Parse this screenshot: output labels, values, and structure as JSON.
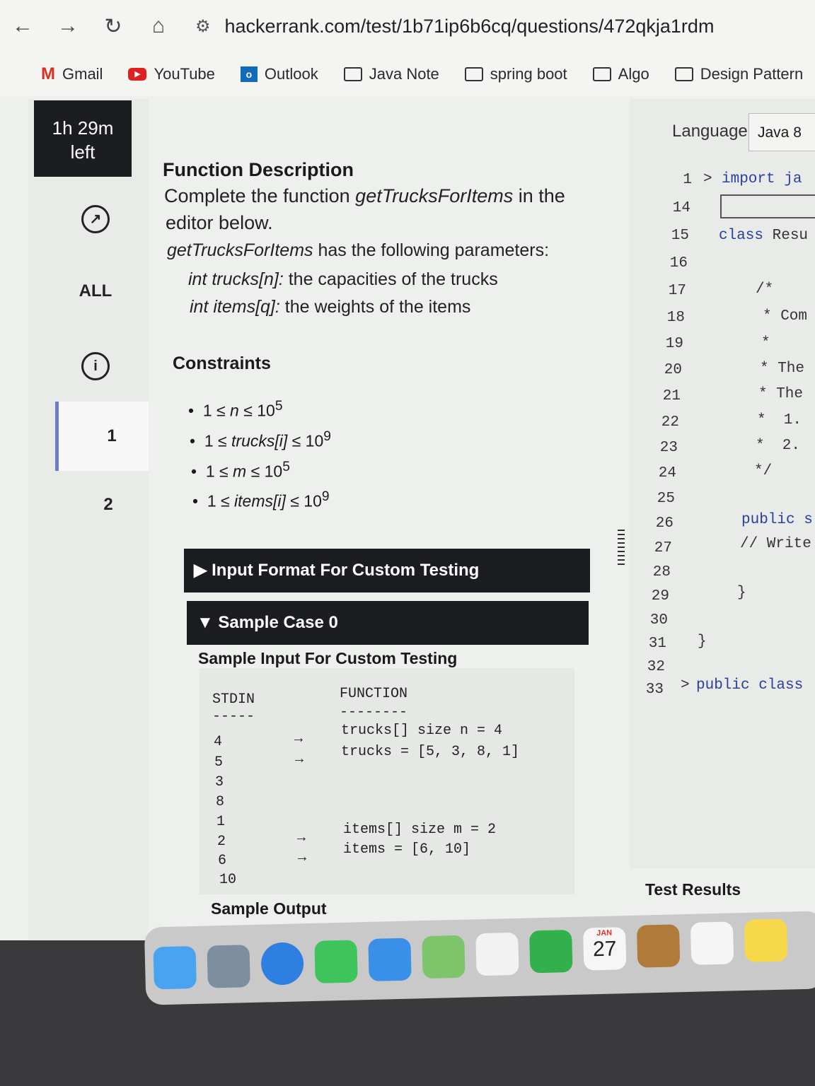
{
  "browser": {
    "url": "hackerrank.com/test/1b71ip6b6cq/questions/472qkja1rdm",
    "bookmarks": [
      {
        "label": "Gmail"
      },
      {
        "label": "YouTube"
      },
      {
        "label": "Outlook"
      },
      {
        "label": "Java Note"
      },
      {
        "label": "spring boot"
      },
      {
        "label": "Algo"
      },
      {
        "label": "Design Pattern"
      }
    ]
  },
  "sidebar": {
    "timer_line1": "1h 29m",
    "timer_line2": "left",
    "all_label": "ALL",
    "questions": [
      "1",
      "2"
    ]
  },
  "problem": {
    "fd_heading": "Function Description",
    "fd_line1_pre": "Complete the function ",
    "fd_line1_fn": "getTrucksForItems",
    "fd_line1_post": " in the",
    "fd_line2": "editor below.",
    "params_fn": "getTrucksForItems",
    "params_text": " has the following parameters:",
    "param1_name": "int trucks[n]:",
    "param1_desc": "the capacities of the trucks",
    "param2_name": "int items[q]:",
    "param2_desc": "the weights of the items",
    "constraints_heading": "Constraints",
    "constraints": [
      {
        "pre": "1 ≤ ",
        "var": "n",
        "post": " ≤ 10",
        "exp": "5"
      },
      {
        "pre": "1 ≤ ",
        "var": "trucks[i]",
        "post": " ≤ 10",
        "exp": "9"
      },
      {
        "pre": "1 ≤ ",
        "var": "m",
        "post": " ≤ 10",
        "exp": "5"
      },
      {
        "pre": "1 ≤ ",
        "var": "items[i]",
        "post": " ≤ 10",
        "exp": "9"
      }
    ],
    "input_format_label": "Input Format For Custom Testing",
    "sample_case_label": "Sample Case 0",
    "sample_input_heading": "Sample Input For Custom Testing",
    "stdin_header": "STDIN",
    "function_header": "FUNCTION",
    "stdin_values": [
      "4",
      "5",
      "3",
      "8",
      "1",
      "2",
      "6",
      "10"
    ],
    "fn_lines": [
      "trucks[] size n = 4",
      "trucks = [5, 3, 8, 1]",
      "items[] size m = 2",
      "items = [6, 10]"
    ],
    "sample_output_heading": "Sample Output"
  },
  "editor": {
    "language_label": "Language",
    "language_value": "Java 8",
    "line_numbers": [
      "1",
      "14",
      "15",
      "16",
      "17",
      "18",
      "19",
      "20",
      "21",
      "22",
      "23",
      "24",
      "25",
      "26",
      "27",
      "28",
      "29",
      "30",
      "31",
      "32",
      "33"
    ],
    "code": {
      "l1": "import ja",
      "l15_kw": "class",
      "l15_rest": " Resu",
      "l17": "/*",
      "l18": "* Com",
      "l19": "*",
      "l20": "* The",
      "l21": "* The",
      "l22": "*  1.",
      "l23": "*  2.",
      "l24": "*/",
      "l26": "public s",
      "l27": "// Write",
      "l29": "}",
      "l31": "}",
      "l33": "public class"
    },
    "test_results_label": "Test Results",
    "calendar_month": "JAN",
    "calendar_day": "27"
  },
  "colors": {
    "accent": "#6b7cc8",
    "dark_bar": "#1b1d21",
    "keyword": "#2a3fa0"
  }
}
